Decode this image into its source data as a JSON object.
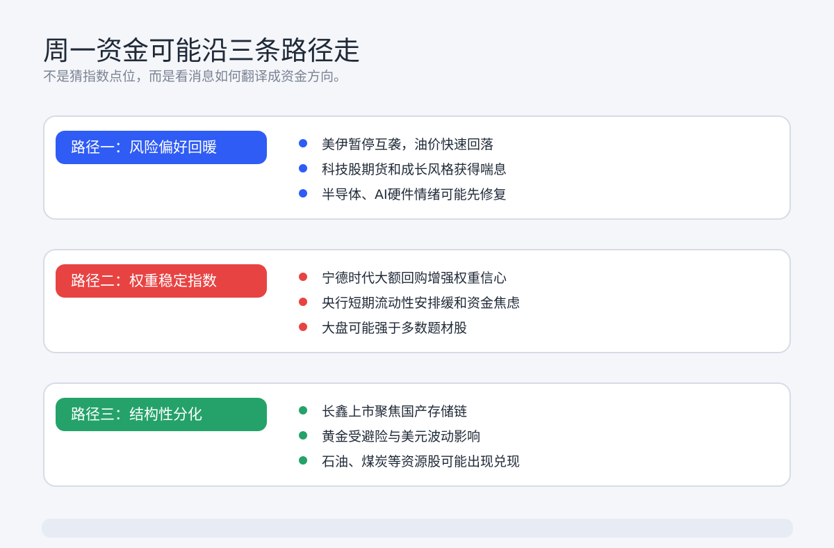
{
  "header": {
    "title": "周一资金可能沿三条路径走",
    "subtitle": "不是猜指数点位，而是看消息如何翻译成资金方向。"
  },
  "colors": {
    "blue": "#2f5cf5",
    "red": "#e84343",
    "green": "#24a26a",
    "card_border": "#d6dbe5",
    "page_background": "#f4f6fa"
  },
  "routes": [
    {
      "label": "路径一：风险偏好回暖",
      "color": "blue",
      "items": [
        "美伊暂停互袭，油价快速回落",
        "科技股期货和成长风格获得喘息",
        "半导体、AI硬件情绪可能先修复"
      ]
    },
    {
      "label": "路径二：权重稳定指数",
      "color": "red",
      "items": [
        "宁德时代大额回购增强权重信心",
        "央行短期流动性安排缓和资金焦虑",
        "大盘可能强于多数题材股"
      ]
    },
    {
      "label": "路径三：结构性分化",
      "color": "green",
      "items": [
        "长鑫上市聚焦国产存储链",
        "黄金受避险与美元波动影响",
        "石油、煤炭等资源股可能出现兑现"
      ]
    }
  ]
}
